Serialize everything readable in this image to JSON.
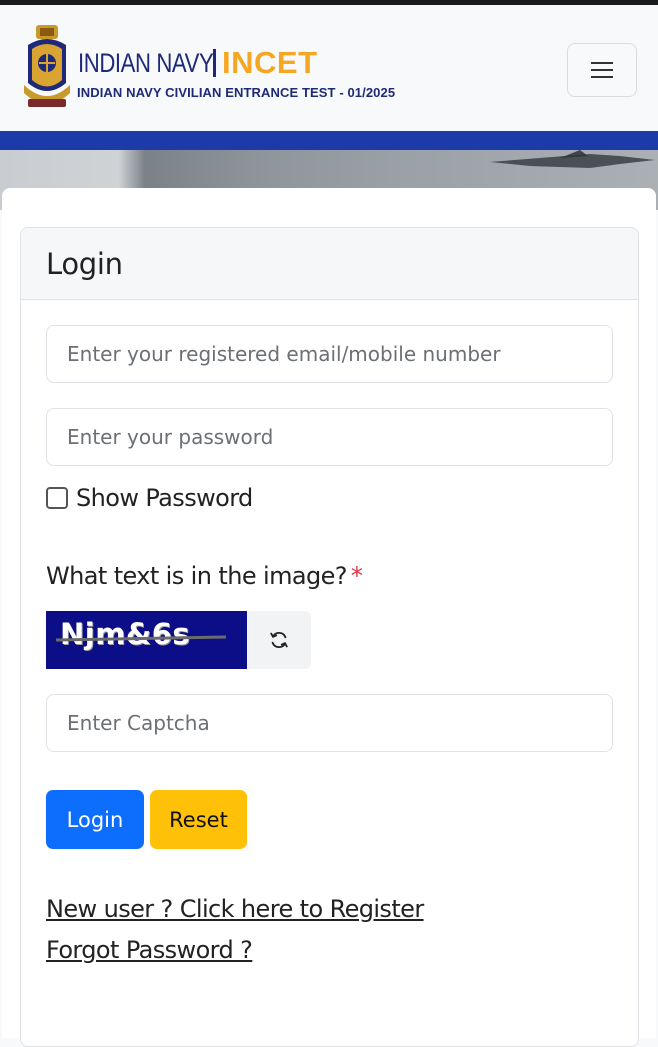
{
  "header": {
    "brand_primary": "INDIAN NAVY",
    "brand_secondary": "INCET",
    "brand_subtitle": "INDIAN NAVY CIVILIAN ENTRANCE TEST - 01/2025",
    "menu_icon": "hamburger-menu-icon"
  },
  "login": {
    "title": "Login",
    "email_placeholder": "Enter your registered email/mobile number",
    "password_placeholder": "Enter your password",
    "show_password_label": "Show Password",
    "show_password_checked": false,
    "captcha_question": "What text is in the image?",
    "captcha_required_mark": "*",
    "captcha_text": "Njm&6s",
    "captcha_refresh_icon": "refresh-icon",
    "captcha_placeholder": "Enter Captcha",
    "login_button": "Login",
    "reset_button": "Reset",
    "register_link": "New user ? Click here to Register",
    "forgot_link": "Forgot Password ?"
  },
  "colors": {
    "brand_blue": "#1e2a78",
    "brand_orange": "#f5a623",
    "strip_blue": "#1c3aa8",
    "primary_button": "#0d6efd",
    "warning_button": "#ffc107",
    "required_red": "#dc3545",
    "captcha_bg": "#0c0e87"
  }
}
